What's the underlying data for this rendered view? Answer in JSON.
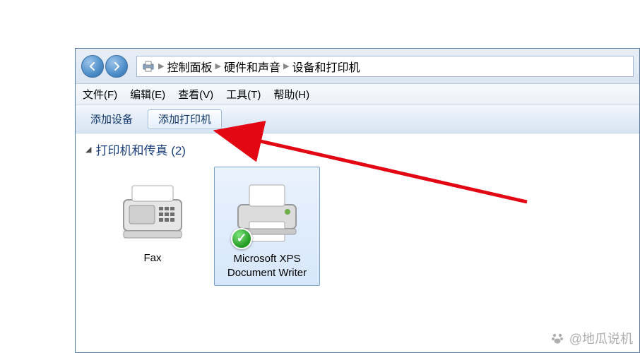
{
  "breadcrumb": {
    "items": [
      "控制面板",
      "硬件和声音",
      "设备和打印机"
    ]
  },
  "menu": {
    "file": "文件(F)",
    "edit": "编辑(E)",
    "view": "查看(V)",
    "tools": "工具(T)",
    "help": "帮助(H)"
  },
  "toolbar": {
    "add_device": "添加设备",
    "add_printer": "添加打印机"
  },
  "category": {
    "header": "打印机和传真 (2)"
  },
  "devices": [
    {
      "label": "Fax"
    },
    {
      "label": "Microsoft XPS Document Writer"
    }
  ],
  "watermark": "@地瓜说机"
}
